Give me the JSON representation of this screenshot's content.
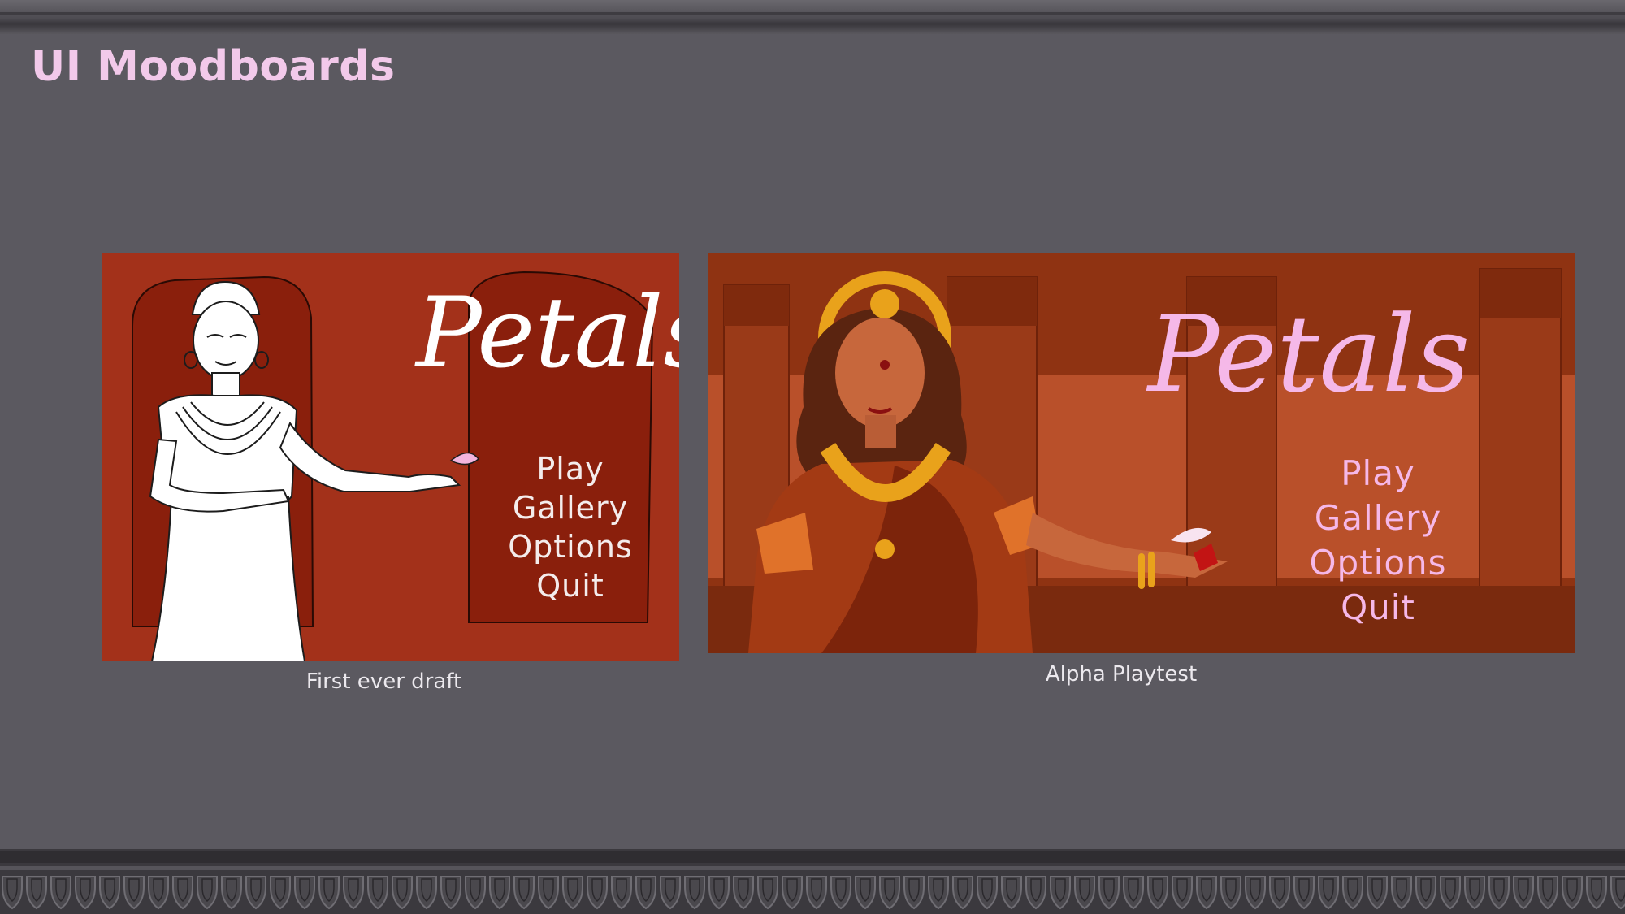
{
  "slide": {
    "title": "UI Moodboards"
  },
  "draft": {
    "logo": "Petals",
    "menu": [
      "Play",
      "Gallery",
      "Options",
      "Quit"
    ],
    "caption": "First ever draft"
  },
  "alpha": {
    "logo": "Petals",
    "menu": [
      "Play",
      "Gallery",
      "Options",
      "Quit"
    ],
    "caption": "Alpha Playtest"
  },
  "colors": {
    "background": "#5b5960",
    "title": "#f2c9ea",
    "draft_bg": "#a3311a",
    "alpha_bg": "#8f3312",
    "alpha_text": "#f5b8e8"
  }
}
